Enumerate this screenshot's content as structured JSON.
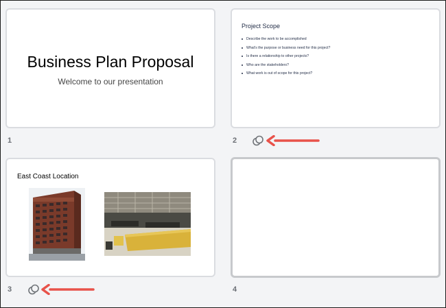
{
  "slides": [
    {
      "number": "1",
      "title": "Business Plan Proposal",
      "subtitle": "Welcome to our presentation"
    },
    {
      "number": "2",
      "title": "Project Scope",
      "bullets": [
        "Describe the work to be accomplished",
        "What's the purpose or business need for this project?",
        "Is there a relationship to other projects?",
        "Who are the stakeholders?",
        "What work is out of scope for this project?"
      ],
      "transition_icon": "transition-icon"
    },
    {
      "number": "3",
      "title": "East Coast Location",
      "transition_icon": "transition-icon"
    },
    {
      "number": "4"
    }
  ],
  "colors": {
    "background": "#f3f4f6",
    "slide_border": "#dadce0",
    "annotation_arrow": "#e8524a"
  }
}
